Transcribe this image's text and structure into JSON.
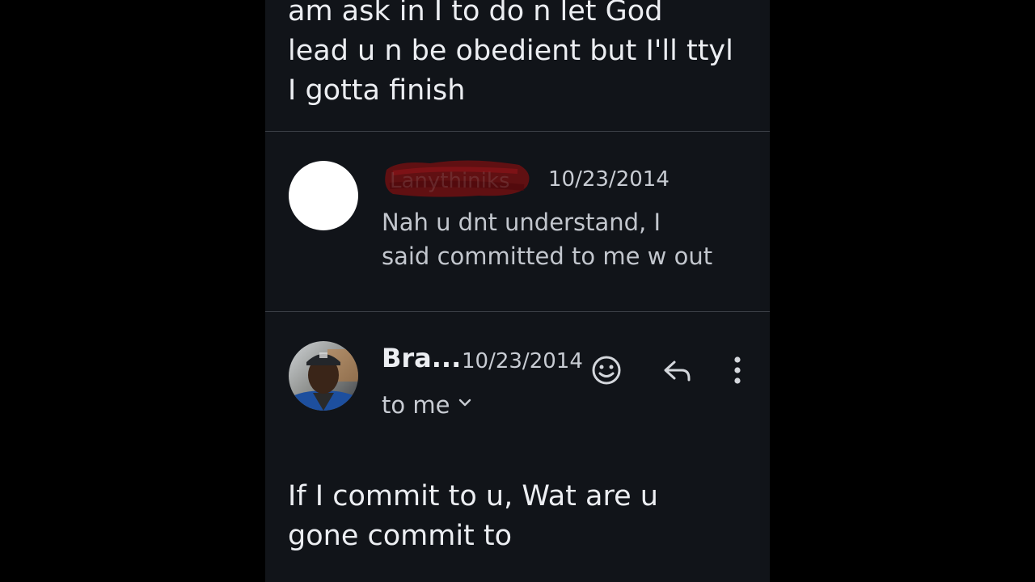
{
  "previous_message": {
    "body_lines": [
      "am ask in I to do n let God",
      "lead u n be obedient but I'll ttyl",
      "I gotta finish"
    ]
  },
  "collapsed_message": {
    "sender": "Lanythiniks",
    "date": "10/23/2014",
    "snippet_lines": [
      "Nah u dnt understand, I",
      "said committed to me w out"
    ]
  },
  "open_message": {
    "sender": "Bra...",
    "date": "10/23/2014",
    "recipients_label": "to me",
    "body_lines": [
      "If I commit to u, Wat are u",
      "gone commit to"
    ]
  },
  "icons": {
    "emoji": "add-reaction-icon",
    "reply": "reply-icon",
    "more": "more-vertical-icon",
    "expand": "chevron-down-icon"
  },
  "colors": {
    "background": "#111419",
    "text": "#eceef2",
    "muted_text": "#c8ccd3",
    "divider": "#3b3f46",
    "redaction": "#6e0f12"
  }
}
